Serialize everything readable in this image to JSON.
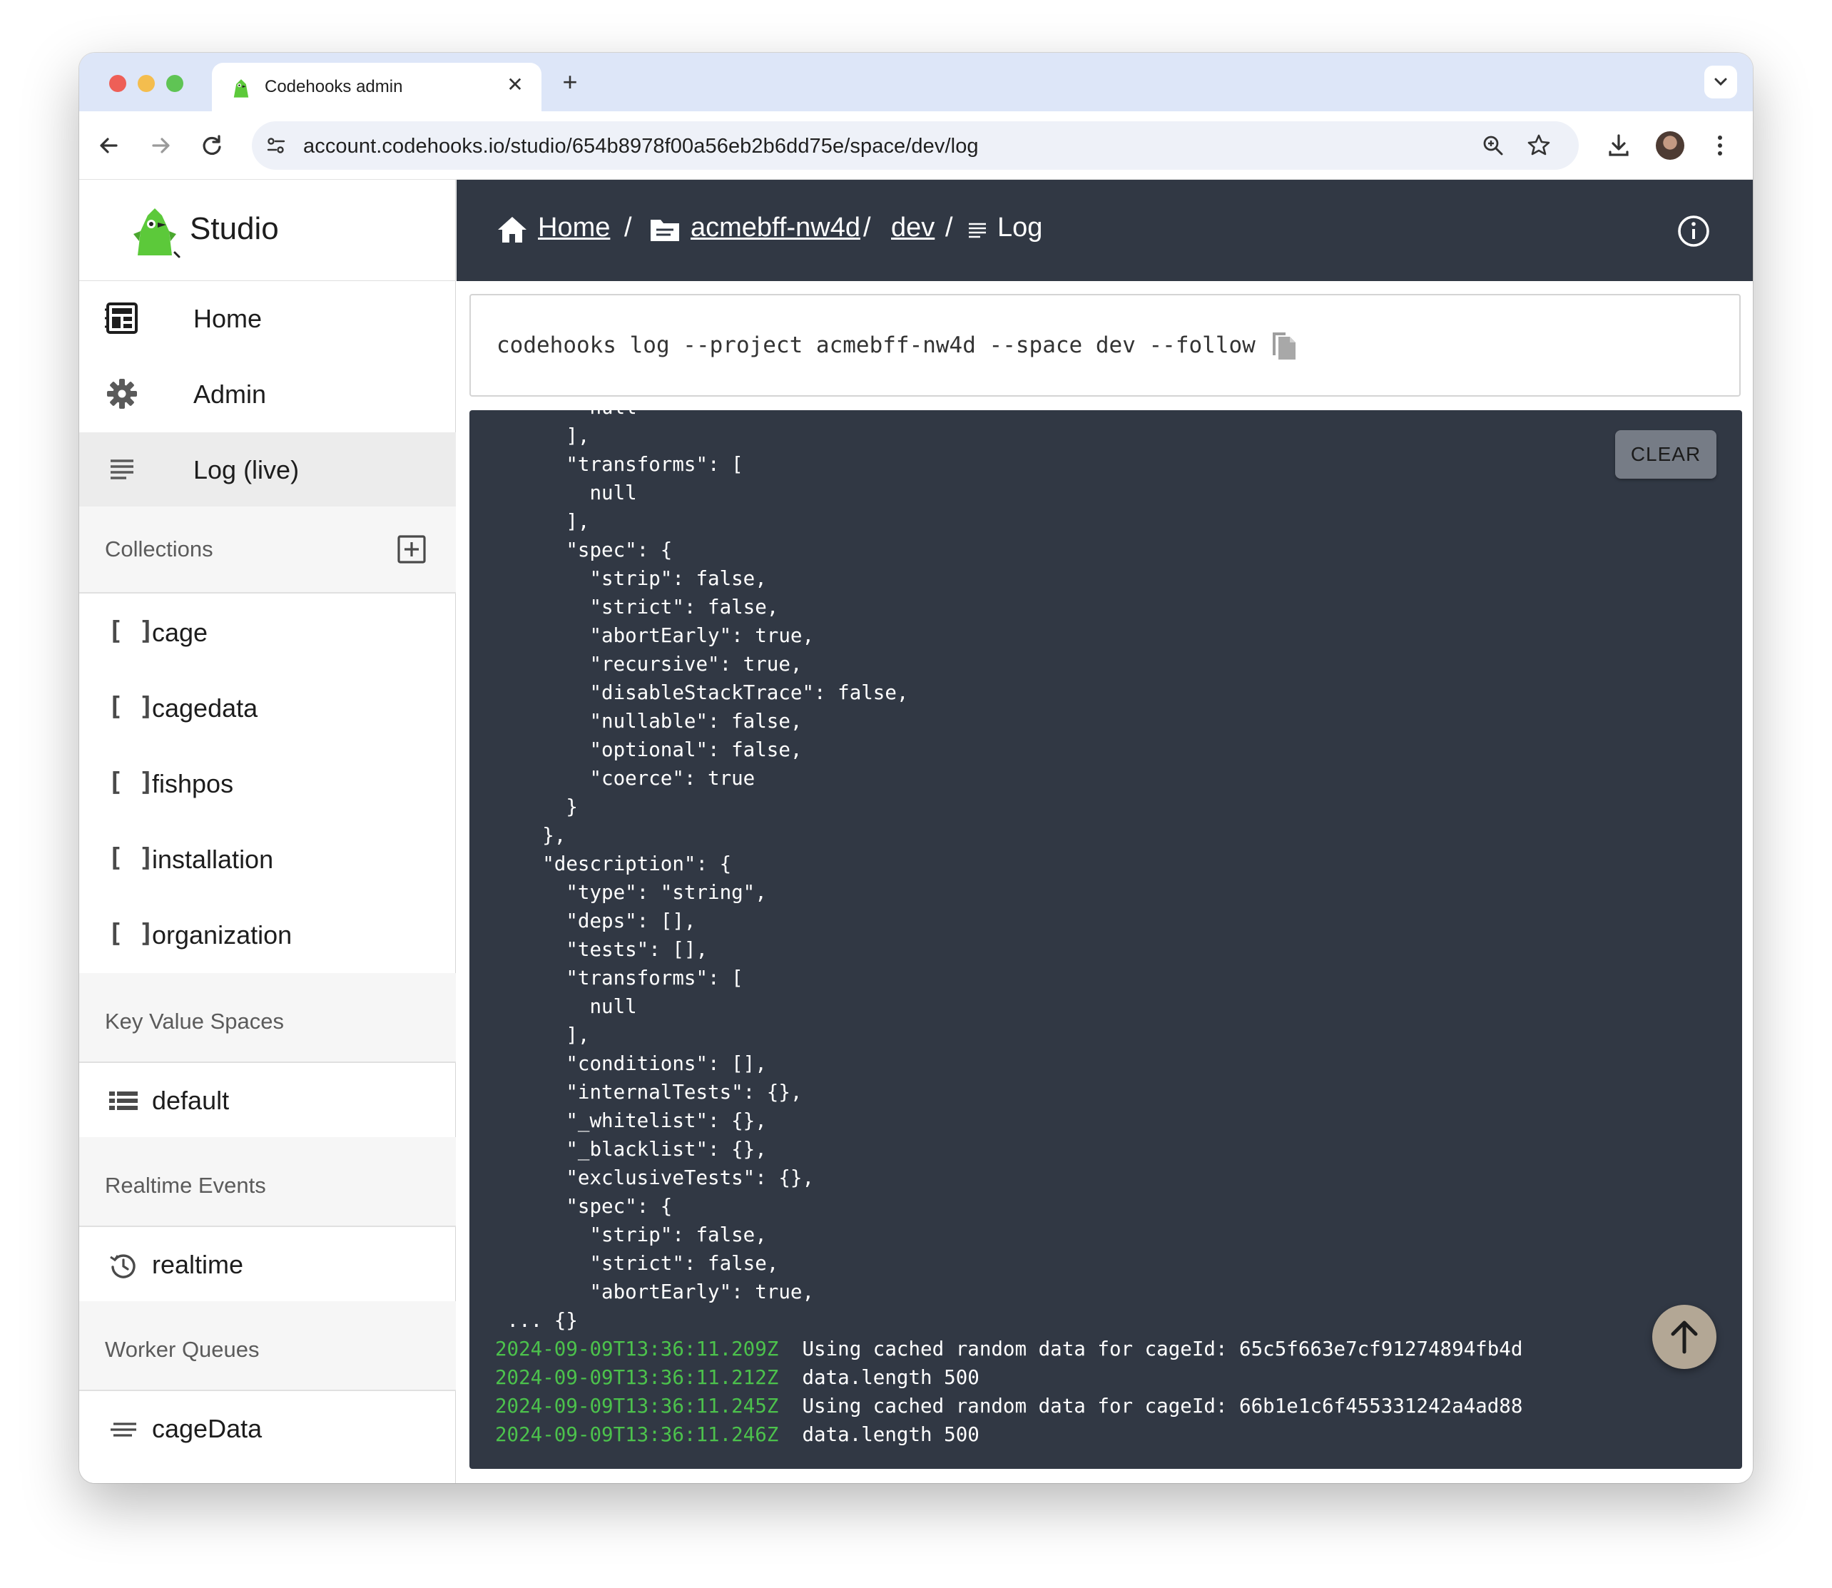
{
  "browser": {
    "tab_title": "Codehooks admin",
    "url": "account.codehooks.io/studio/654b8978f00a56eb2b6dd75e/space/dev/log"
  },
  "sidebar": {
    "brand": "Studio",
    "nav": [
      {
        "label": "Home",
        "icon": "home-grid-icon"
      },
      {
        "label": "Admin",
        "icon": "gear-icon"
      },
      {
        "label": "Log (live)",
        "icon": "lines-icon"
      }
    ],
    "collections_title": "Collections",
    "collections": [
      "cage",
      "cagedata",
      "fishpos",
      "installation",
      "organization"
    ],
    "kv_title": "Key Value Spaces",
    "kv_items": [
      "default"
    ],
    "realtime_title": "Realtime Events",
    "realtime_items": [
      "realtime"
    ],
    "queues_title": "Worker Queues",
    "queue_items": [
      "cageData"
    ]
  },
  "breadcrumb": {
    "home": "Home",
    "project": "acmebff-nw4d",
    "space": "dev",
    "page": "Log",
    "sep": "/"
  },
  "command": "codehooks log --project acmebff-nw4d --space dev --follow",
  "log": {
    "clear_label": "CLEAR",
    "lines": [
      {
        "indent": "        ",
        "text": "null"
      },
      {
        "indent": "      ",
        "text": "],"
      },
      {
        "indent": "      ",
        "text": "\"transforms\": ["
      },
      {
        "indent": "        ",
        "text": "null"
      },
      {
        "indent": "      ",
        "text": "],"
      },
      {
        "indent": "      ",
        "text": "\"spec\": {"
      },
      {
        "indent": "        ",
        "text": "\"strip\": false,"
      },
      {
        "indent": "        ",
        "text": "\"strict\": false,"
      },
      {
        "indent": "        ",
        "text": "\"abortEarly\": true,"
      },
      {
        "indent": "        ",
        "text": "\"recursive\": true,"
      },
      {
        "indent": "        ",
        "text": "\"disableStackTrace\": false,"
      },
      {
        "indent": "        ",
        "text": "\"nullable\": false,"
      },
      {
        "indent": "        ",
        "text": "\"optional\": false,"
      },
      {
        "indent": "        ",
        "text": "\"coerce\": true"
      },
      {
        "indent": "      ",
        "text": "}"
      },
      {
        "indent": "    ",
        "text": "},"
      },
      {
        "indent": "    ",
        "text": "\"description\": {"
      },
      {
        "indent": "      ",
        "text": "\"type\": \"string\","
      },
      {
        "indent": "      ",
        "text": "\"deps\": [],"
      },
      {
        "indent": "      ",
        "text": "\"tests\": [],"
      },
      {
        "indent": "      ",
        "text": "\"transforms\": ["
      },
      {
        "indent": "        ",
        "text": "null"
      },
      {
        "indent": "      ",
        "text": "],"
      },
      {
        "indent": "      ",
        "text": "\"conditions\": [],"
      },
      {
        "indent": "      ",
        "text": "\"internalTests\": {},"
      },
      {
        "indent": "      ",
        "text": "\"_whitelist\": {},"
      },
      {
        "indent": "      ",
        "text": "\"_blacklist\": {},"
      },
      {
        "indent": "      ",
        "text": "\"exclusiveTests\": {},"
      },
      {
        "indent": "      ",
        "text": "\"spec\": {"
      },
      {
        "indent": "        ",
        "text": "\"strip\": false,"
      },
      {
        "indent": "        ",
        "text": "\"strict\": false,"
      },
      {
        "indent": "        ",
        "text": "\"abortEarly\": true,"
      },
      {
        "indent": "",
        "text": " ... {}"
      }
    ],
    "entries": [
      {
        "ts": "2024-09-09T13:36:11.209Z",
        "msg": "Using cached random data for cageId: 65c5f663e7cf91274894fb4d"
      },
      {
        "ts": "2024-09-09T13:36:11.212Z",
        "msg": "data.length 500"
      },
      {
        "ts": "2024-09-09T13:36:11.245Z",
        "msg": "Using cached random data for cageId: 66b1e1c6f455331242a4ad88"
      },
      {
        "ts": "2024-09-09T13:36:11.246Z",
        "msg": "data.length 500"
      }
    ]
  },
  "colors": {
    "topbar": "#313844",
    "log_bg": "#313844",
    "timestamp": "#4cc24c",
    "brand_green": "#5cc93a"
  }
}
